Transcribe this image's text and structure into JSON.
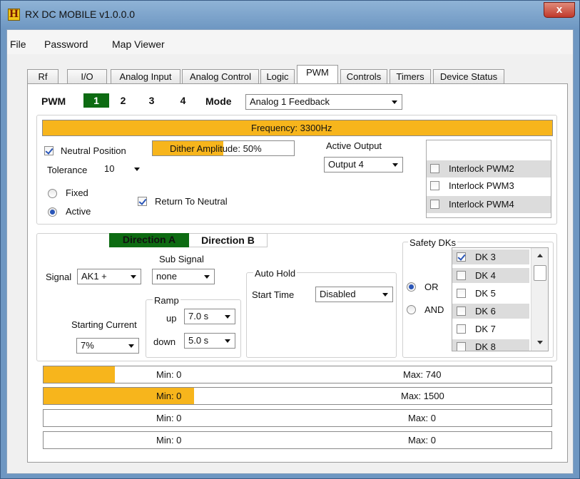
{
  "window": {
    "title": "RX DC MOBILE v1.0.0.0",
    "logo": "H",
    "close": "x"
  },
  "menu": [
    "File",
    "Password",
    "Map Viewer"
  ],
  "tabs": [
    "Rf",
    "I/O",
    "Analog Input",
    "Analog Control",
    "Logic",
    "PWM",
    "Controls",
    "Timers",
    "Device Status"
  ],
  "active_tab": "PWM",
  "pwm": {
    "label": "PWM",
    "channels": [
      "1",
      "2",
      "3",
      "4"
    ],
    "selected_channel": "1",
    "mode_label": "Mode",
    "mode_value": "Analog 1 Feedback"
  },
  "frequency": {
    "text": "Frequency: 3300Hz",
    "fill": 1.0
  },
  "neutral": {
    "label": "Neutral Position",
    "checked": true,
    "tolerance_label": "Tolerance",
    "tolerance_value": "10"
  },
  "dither": {
    "text": "Dither Amplitude: 50%",
    "fill": 0.5
  },
  "mode_radio": {
    "fixed": "Fixed",
    "active": "Active",
    "selected": "Active"
  },
  "return_to_neutral": {
    "label": "Return To Neutral",
    "checked": true
  },
  "active_output": {
    "label": "Active Output",
    "value": "Output 4"
  },
  "interlocks": [
    {
      "label": "Interlock PWM2",
      "checked": false
    },
    {
      "label": "Interlock PWM3",
      "checked": false
    },
    {
      "label": "Interlock PWM4",
      "checked": false
    }
  ],
  "direction": {
    "a": "Direction A",
    "b": "Direction B",
    "selected": "Direction A"
  },
  "signal": {
    "label": "Signal",
    "value": "AK1 +",
    "sub_label": "Sub Signal",
    "sub_value": "none"
  },
  "ramp": {
    "label": "Ramp",
    "up_label": "up",
    "up_value": "7.0 s",
    "down_label": "down",
    "down_value": "5.0 s"
  },
  "starting_current": {
    "label": "Starting Current",
    "value": "7%"
  },
  "auto_hold": {
    "label": "Auto Hold",
    "start_label": "Start Time",
    "start_value": "Disabled"
  },
  "safety": {
    "label": "Safety DKs",
    "or_label": "OR",
    "and_label": "AND",
    "selected": "OR",
    "dks": [
      {
        "label": "DK 3",
        "checked": true
      },
      {
        "label": "DK 4",
        "checked": false
      },
      {
        "label": "DK 5",
        "checked": false
      },
      {
        "label": "DK 6",
        "checked": false
      },
      {
        "label": "DK 7",
        "checked": false
      },
      {
        "label": "DK 8",
        "checked": false
      }
    ]
  },
  "bars": [
    {
      "min": "Min: 0",
      "max": "Max: 740",
      "fill": 0.14
    },
    {
      "min": "Min: 0",
      "max": "Max: 1500",
      "fill": 0.297
    },
    {
      "min": "Min: 0",
      "max": "Max: 0",
      "fill": 0
    },
    {
      "min": "Min: 0",
      "max": "Max: 0",
      "fill": 0
    }
  ],
  "colors": {
    "accent_green": "#0d6b12",
    "bar_fill": "#f7b51c",
    "check_blue": "#2a56b8"
  }
}
